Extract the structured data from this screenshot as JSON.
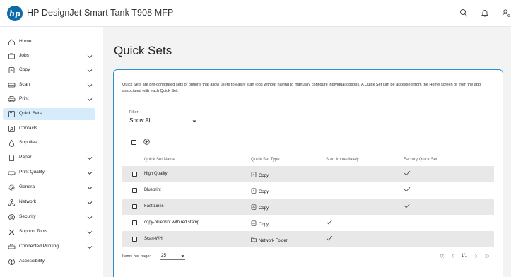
{
  "header": {
    "logo_text": "hp",
    "title": "HP DesignJet Smart Tank T908 MFP",
    "icons": [
      "search-icon",
      "bell-icon",
      "user-settings-icon"
    ]
  },
  "sidebar": {
    "items": [
      {
        "label": "Home",
        "icon": "home-icon",
        "expandable": false,
        "active": false
      },
      {
        "label": "Jobs",
        "icon": "jobs-icon",
        "expandable": true,
        "active": false
      },
      {
        "label": "Copy",
        "icon": "copy-icon",
        "expandable": true,
        "active": false
      },
      {
        "label": "Scan",
        "icon": "scan-icon",
        "expandable": true,
        "active": false
      },
      {
        "label": "Print",
        "icon": "print-icon",
        "expandable": true,
        "active": false
      },
      {
        "label": "Quick Sets",
        "icon": "quick-sets-icon",
        "expandable": false,
        "active": true
      },
      {
        "label": "Contacts",
        "icon": "contacts-icon",
        "expandable": false,
        "active": false
      },
      {
        "label": "Supplies",
        "icon": "supplies-icon",
        "expandable": false,
        "active": false
      },
      {
        "label": "Paper",
        "icon": "paper-icon",
        "expandable": true,
        "active": false
      },
      {
        "label": "Print Quality",
        "icon": "print-quality-icon",
        "expandable": true,
        "active": false
      },
      {
        "label": "General",
        "icon": "general-icon",
        "expandable": true,
        "active": false
      },
      {
        "label": "Network",
        "icon": "network-icon",
        "expandable": true,
        "active": false
      },
      {
        "label": "Security",
        "icon": "security-icon",
        "expandable": true,
        "active": false
      },
      {
        "label": "Support Tools",
        "icon": "support-tools-icon",
        "expandable": true,
        "active": false
      },
      {
        "label": "Connected Printing",
        "icon": "connected-printing-icon",
        "expandable": true,
        "active": false
      },
      {
        "label": "Accessibility",
        "icon": "accessibility-icon",
        "expandable": false,
        "active": false
      }
    ]
  },
  "main": {
    "title": "Quick Sets",
    "description": "Quick Sets are pre-configured sets of options that allow users to easily start jobs without having to manually configure individual options. A Quick Set can be accessed from the Home screen or from the app associated with each Quick Set.",
    "filter": {
      "label": "Filter",
      "value": "Show All"
    },
    "table": {
      "columns": [
        "Quick Set Name",
        "Quick Set Type",
        "Start Immediately",
        "Factory Quick Set"
      ],
      "rows": [
        {
          "name": "High Quality",
          "type": "Copy",
          "type_icon": "copy-icon",
          "start_immediately": false,
          "factory": true
        },
        {
          "name": "Blueprint",
          "type": "Copy",
          "type_icon": "copy-icon",
          "start_immediately": false,
          "factory": true
        },
        {
          "name": "Fast Lines",
          "type": "Copy",
          "type_icon": "copy-icon",
          "start_immediately": false,
          "factory": true
        },
        {
          "name": "copy-blueprint with red stamp",
          "type": "Copy",
          "type_icon": "copy-icon",
          "start_immediately": true,
          "factory": false
        },
        {
          "name": "Scan-WH",
          "type": "Network Folder",
          "type_icon": "folder-icon",
          "start_immediately": true,
          "factory": false
        }
      ]
    },
    "pagination": {
      "items_per_page_label": "Items per page:",
      "items_per_page_value": "25",
      "page_indicator": "1/1"
    }
  },
  "colors": {
    "accent": "#2e8fd0",
    "active_nav_bg": "#d6ecfb",
    "logo_bg": "#0e6aa8",
    "row_alt_bg": "#e8e8e8",
    "page_bg": "#f3f3f3"
  }
}
